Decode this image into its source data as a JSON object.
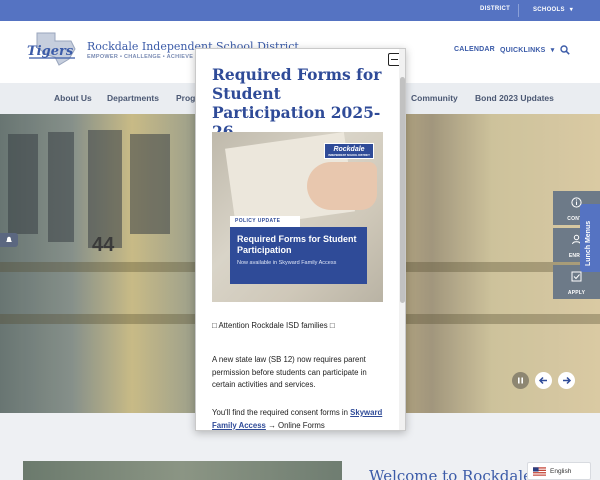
{
  "topbar": {
    "district_label": "DISTRICT",
    "schools_label": "SCHOOLS",
    "schools_caret": "▾"
  },
  "header": {
    "logo_text": "Tigers",
    "school_name": "Rockdale Independent School District",
    "tagline": "EMPOWER • CHALLENGE • ACHIEVE",
    "calendar_label": "CALENDAR",
    "quicklinks_label": "QUICKLINKS",
    "quicklinks_caret": "▾"
  },
  "nav": {
    "items": [
      "About Us",
      "Departments",
      "Prog",
      "Community",
      "Bond 2023 Updates"
    ]
  },
  "hero": {
    "side_buttons": [
      {
        "label": "CONTA",
        "icon": "info-icon"
      },
      {
        "label": "ENRO",
        "icon": "user-icon"
      },
      {
        "label": "APPLY",
        "icon": "check-icon"
      }
    ],
    "lunch_menus_label": "Lunch Menus",
    "bus_number": "44"
  },
  "below": {
    "welcome": "Welcome to Rockdale",
    "language": "English"
  },
  "modal": {
    "title": "Required Forms for Student Participation 2025-26",
    "flyer": {
      "logo": "Rockdale",
      "logo_sub": "INDEPENDENT SCHOOL DISTRICT",
      "tag": "POLICY UPDATE",
      "headline": "Required Forms for Student Participation",
      "sub": "Now available in Skyward Family Access"
    },
    "attention": "□ Attention Rockdale ISD families □",
    "p1": "A new state law (SB 12) now requires parent permission before students can participate in certain activities and services.",
    "p2_prefix": "You'll find the required consent forms in",
    "p2_link": "Skyward Family Access",
    "p2_suffix": "→ Online Forms"
  },
  "colors": {
    "brand_blue": "#5573c2",
    "title_blue": "#2f4b98",
    "nav_bg": "#eaedf1"
  }
}
